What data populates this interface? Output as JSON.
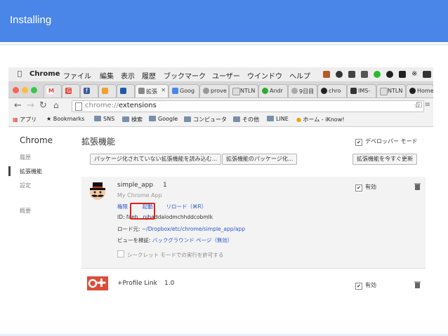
{
  "slide": {
    "title": "Installing",
    "header_color": "#4a86e8"
  },
  "menubar": {
    "items": [
      "Chrome",
      "ファイル",
      "編集",
      "表示",
      "履歴",
      "ブックマーク",
      "ユーザー",
      "ウインドウ",
      "ヘルプ"
    ]
  },
  "tabs": [
    {
      "label": "M"
    },
    {
      "label": "G"
    },
    {
      "label": "f"
    },
    {
      "label": ""
    },
    {
      "label": ""
    },
    {
      "label": "拡張"
    },
    {
      "label": "Goog"
    },
    {
      "label": "prove"
    },
    {
      "label": "NTLN"
    },
    {
      "label": "Andr"
    },
    {
      "label": "9日目"
    },
    {
      "label": "chro"
    },
    {
      "label": "IMS-"
    },
    {
      "label": "NTLN"
    },
    {
      "label": "Home"
    }
  ],
  "toolbar": {
    "url_scheme": "chrome://",
    "url_path": "extensions"
  },
  "bookmarks": {
    "apps_label": "アプリ",
    "items": [
      "Bookmarks",
      "SNS",
      "検索",
      "Google",
      "コンピュータ",
      "その他",
      "LINE",
      "ホーム - iKnow!"
    ]
  },
  "sidebar": {
    "title": "Chrome",
    "items": [
      "履歴",
      "拡張機能",
      "設定",
      "概要"
    ]
  },
  "main": {
    "title": "拡張機能",
    "developer_mode_label": "デベロッパー モード",
    "developer_mode_checked": true,
    "buttons": [
      "パッケージ化されていない拡張機能を読み込む...",
      "拡張機能のパッケージ化...",
      "拡張機能を今すぐ更新"
    ]
  },
  "extensions": [
    {
      "name": "simple_app",
      "version": "1",
      "description": "My Chrome App",
      "permissions_link": "権限",
      "launch_link": "起動",
      "reload_link": "リロード（⌘R）",
      "id_label": "ID:",
      "id_value": "faeb...njbaddalodmchhddcobmlk",
      "load_path_label": "ロード元:",
      "load_path": "~/Dropbox/etc/chrome/simple_app/app",
      "inspect_label": "ビューを検証:",
      "inspect_link": "バックグラウンド ページ（無効）",
      "incognito_label": "シークレット モードでの実行を許可する",
      "enabled_label": "有効",
      "enabled": true
    },
    {
      "name": "+Profile Link",
      "version": "1.0",
      "enabled_label": "有効",
      "enabled": true
    }
  ],
  "highlight_color": "#e02020"
}
